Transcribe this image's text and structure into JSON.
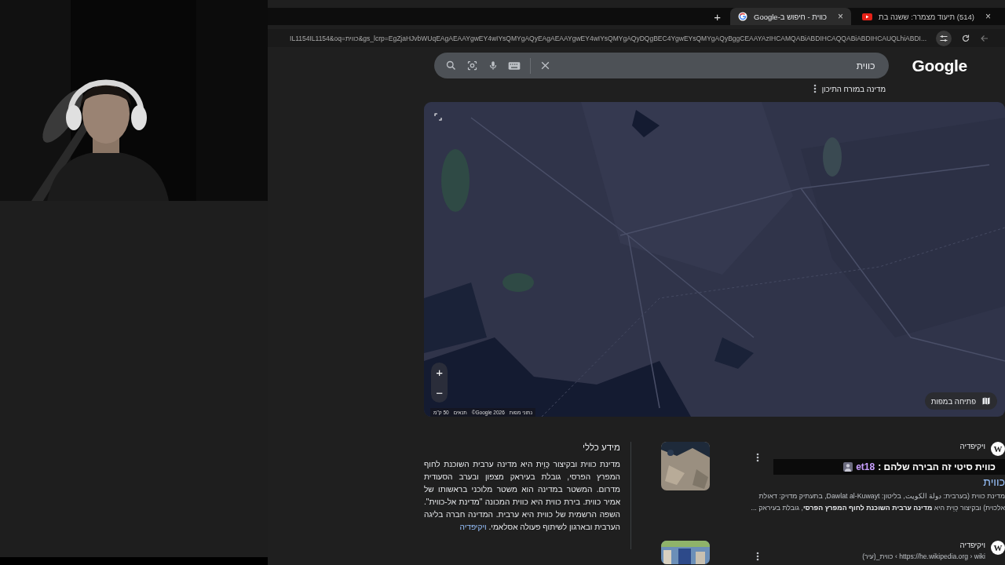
{
  "tabs": [
    {
      "title": "(514) תיעוד מצמרר: ששנה בת",
      "close": "×",
      "selected": false
    },
    {
      "title": "כווית - חיפוש ב-Google",
      "close": "×",
      "selected": true
    }
  ],
  "new_tab": "+",
  "address": {
    "url": "IL1154IL1154&oq=כווית&gs_lcrp=EgZjaHJvbWUqEAgAEAAYgwEY4wIYsQMYgAQyEAgAEAAYgwEY4wIYsQMYgAQyDQgBEC4YgwEYsQMYgAQyBggCEAAYAzIHCAMQABiABDIHCAQQABiABDIHCAUQLhiABDI..."
  },
  "logo": "Google",
  "search": {
    "value": "כווית"
  },
  "subtitle": "מדינה במזרח התיכון",
  "map": {
    "kind": "picture",
    "zoom_in": "+",
    "zoom_out": "−",
    "open_button": "פתיחה במפות",
    "attribution": [
      "נתוני מפות",
      "Google 2026©",
      "תנאים",
      "50 ק\"מ"
    ]
  },
  "info": {
    "heading": "מידע כללי",
    "text": "מדינת כווית ובקיצור כֻּוֵית היא מדינה ערבית השוכנת לחוף המפרץ הפרסי, גובלת בעיראק מצפון ובערב הסעודית מדרום. המשטר במדינה הוא משטר מלוכני בראשותו של אמיר כווית. בירת כווית היא כווית המכונה \"מדינת אל-כווית\". השפה הרשמית של כווית היא ערבית. המדינה חברה בליגה הערבית ובארגון לשיתוף פעולה אסלאמי.",
    "link": "ויקיפדיה"
  },
  "results": [
    {
      "logo": "W",
      "source": "ויקיפדיה",
      "title": "כווית",
      "snippet": "מדינת כווית (בערבית: دولة الكويت, בליטון: Dawlat al-Kuwayt, בתעתיק מדויק: דאולת אלכוית) ובקיצור כֻּוֵית היא **מדינה ערבית השוכנת לחוף המפרץ הפרסי**, גובלת בעיראק ..."
    },
    {
      "logo": "W",
      "source": "ויקיפדיה",
      "breadcrumb": "https://he.wikipedia.org › wiki › כווית_(עיר)"
    }
  ],
  "chat": {
    "user": "et18",
    "message": "כווית סיטי זה הבירה שלהם :"
  }
}
